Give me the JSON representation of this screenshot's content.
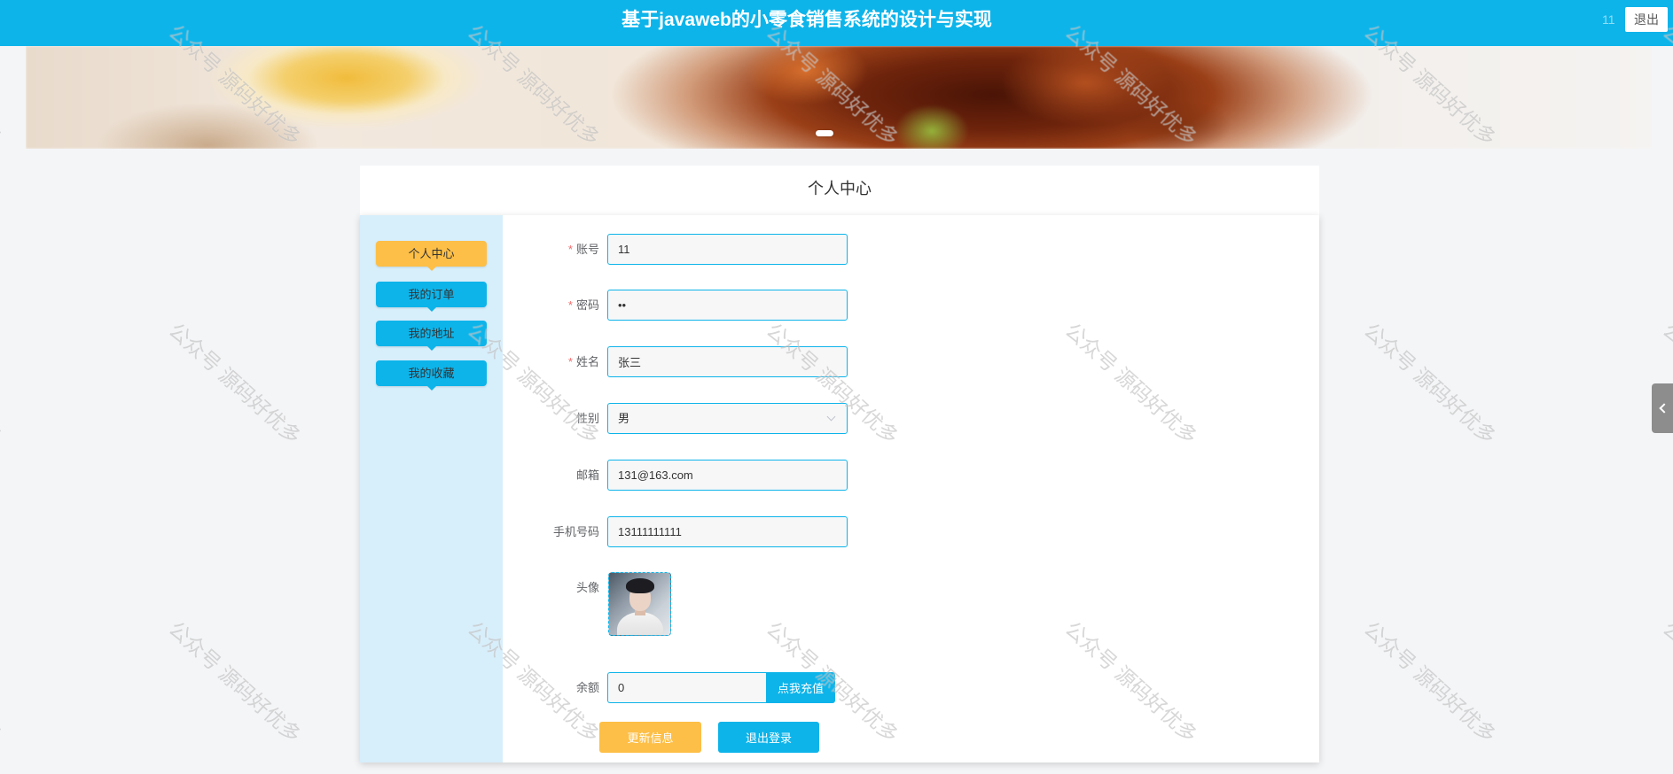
{
  "header": {
    "title": "基于javaweb的小零食销售系统的设计与实现",
    "username": "11",
    "logout_label": "退出"
  },
  "page_title": "个人中心",
  "sidebar": {
    "items": [
      {
        "label": "个人中心",
        "active": true
      },
      {
        "label": "我的订单",
        "active": false
      },
      {
        "label": "我的地址",
        "active": false
      },
      {
        "label": "我的收藏",
        "active": false
      }
    ]
  },
  "form": {
    "required_mark": "*",
    "fields": {
      "account": {
        "label": "账号",
        "value": "11",
        "required": true
      },
      "password": {
        "label": "密码",
        "value": "••",
        "required": true
      },
      "name": {
        "label": "姓名",
        "value": "张三",
        "required": true
      },
      "gender": {
        "label": "性别",
        "value": "男",
        "required": false
      },
      "email": {
        "label": "邮箱",
        "value": "131@163.com",
        "required": false
      },
      "phone": {
        "label": "手机号码",
        "value": "13111111111",
        "required": false
      },
      "avatar": {
        "label": "头像"
      },
      "balance": {
        "label": "余额",
        "value": "0",
        "action_label": "点我充值"
      }
    },
    "actions": {
      "update_label": "更新信息",
      "logout_label": "退出登录"
    }
  },
  "icons": {
    "select_arrow": "chevron-down-icon",
    "side_toggle": "chevron-left-icon"
  },
  "watermark": {
    "text": "公众号 源码好优多"
  },
  "colors": {
    "primary": "#0db4ea",
    "accent": "#fdbf47",
    "sidebar_bg": "#d7eefb",
    "required": "#f56c6c",
    "page_bg": "#f4f5f7"
  }
}
